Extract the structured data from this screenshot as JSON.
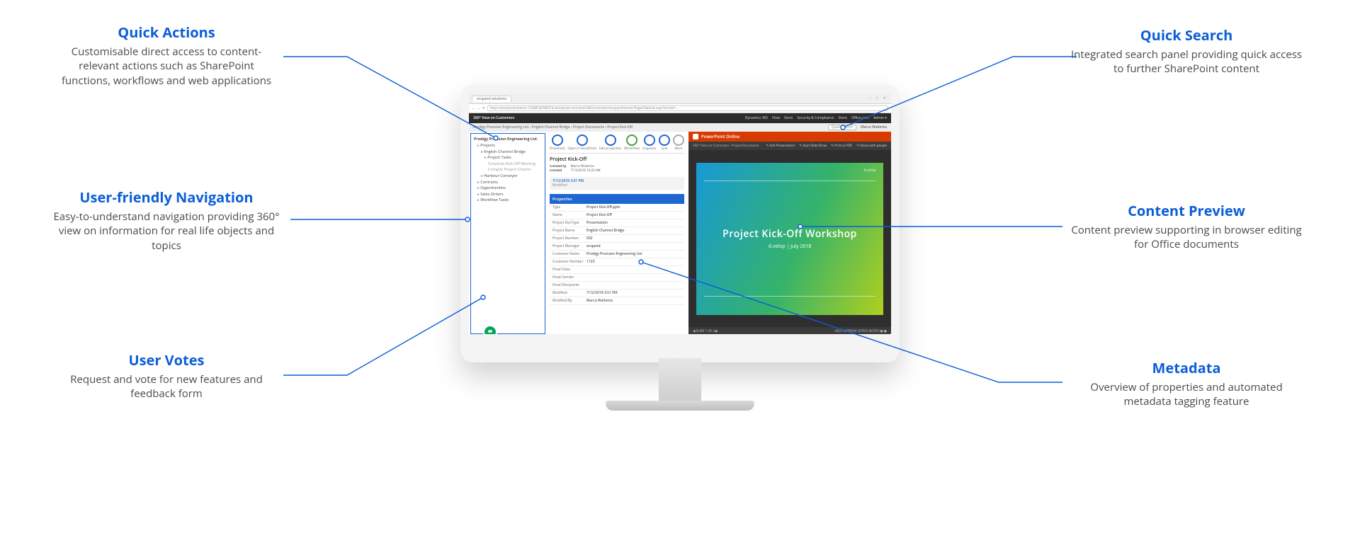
{
  "callouts": {
    "quick_actions": {
      "title": "Quick Actions",
      "body": "Customisable direct access to content-relevant actions such as SharePoint functions, workflows and web applications"
    },
    "quick_search": {
      "title": "Quick Search",
      "body": "Integrated search panel providing quick access to further SharePoint content"
    },
    "nav": {
      "title": "User-friendly Navigation",
      "body": "Easy-to-understand navigation providing 360° view on information for real life objects and topics"
    },
    "preview": {
      "title": "Content Preview",
      "body": "Content preview supporting in browser editing for Office documents"
    },
    "votes": {
      "title": "User Votes",
      "body": "Request and vote for new features and feedback form"
    },
    "metadata": {
      "title": "Metadata",
      "body": "Overview of properties and automated metadata tagging feature"
    }
  },
  "browser": {
    "tab_title": "ecspand solutions",
    "url": "https://ecspandsolutions-154387a8186516.sharepoint.com/sites/360/customers/ecspand/center/Pages/Default.aspx?termId=…",
    "win_controls": "–  □  ✕"
  },
  "topbar": {
    "brand": "360° View on Customers",
    "links": [
      "Dynamics 365",
      "Flow",
      "Store",
      "Security & Compliance",
      "Store",
      "Office.com"
    ],
    "admin": "Admin ▾"
  },
  "contextbar": {
    "breadcrumb": "Prodigy Precision Engineering Ltd.  ›  English Channel Bridge  ›  Project Documents  ›  Project Kick-Off",
    "quick_search": "Quick Search",
    "user": "Marco Waltenta"
  },
  "tree": {
    "root": "Prodigy Precision Engineering Ltd.",
    "items": [
      {
        "label": "Projects",
        "children": [
          {
            "label": "English Channel Bridge",
            "children": [
              {
                "label": "Project Tasks",
                "children": [
                  {
                    "label": "Schedule Kick-Off Meeting"
                  },
                  {
                    "label": "Compile Project Charter"
                  }
                ]
              }
            ]
          },
          {
            "label": "Harbour Conveyor"
          }
        ]
      },
      {
        "label": "Contracts"
      },
      {
        "label": "Opportunities"
      },
      {
        "label": "Sales Orders"
      },
      {
        "label": "Workflow Tasks"
      }
    ]
  },
  "toolbar": {
    "items": [
      "Download",
      "Open in SharePoint",
      "Edit properties",
      "Workflows",
      "Organize",
      "Link",
      "More"
    ]
  },
  "doc": {
    "title": "Project Kick-Off",
    "created_by_label": "Created by",
    "created_by": "Marco Waltenta",
    "created_label": "Created",
    "created": "7/12/2018 10:22 AM",
    "timestamp": "7/12/2018 3:51 PM",
    "timestamp_label": "Modified"
  },
  "properties": {
    "header": "Properties",
    "rows": [
      {
        "k": "Type",
        "v": "Project Kick-Off.pptx"
      },
      {
        "k": "Name",
        "v": "Project Kick-Off"
      },
      {
        "k": "Project DocType",
        "v": "Presentation"
      },
      {
        "k": "Project Name",
        "v": "English Channel Bridge"
      },
      {
        "k": "Project Number",
        "v": "002"
      },
      {
        "k": "Project Manager",
        "v": "ecspand"
      },
      {
        "k": "Customer Name",
        "v": "Prodigy Precision Engineering Ltd."
      },
      {
        "k": "Customer Number",
        "v": "1123"
      },
      {
        "k": "Email Date",
        "v": ""
      },
      {
        "k": "Email Sender",
        "v": ""
      },
      {
        "k": "Email Recipients",
        "v": ""
      },
      {
        "k": "Modified",
        "v": "7/12/2018 3:51 PM"
      },
      {
        "k": "Modified By",
        "v": "Marco Waltenta"
      }
    ]
  },
  "powerpoint": {
    "band": "PowerPoint Online",
    "crumb": "360° View on Customers  ›  ProjectDocuments",
    "actions": [
      "Edit Presentation",
      "Start Slide Show",
      "Print to PDF",
      "Share with people"
    ],
    "brand_tag": "d.velop",
    "slide_title": "Project Kick-Off Workshop",
    "slide_sub": "d.velop | July 2018",
    "footer_left": "SLIDE 1 OF 4",
    "footer_right": "HELP IMPROVE OFFICE   NOTES   ▣ ▣"
  }
}
